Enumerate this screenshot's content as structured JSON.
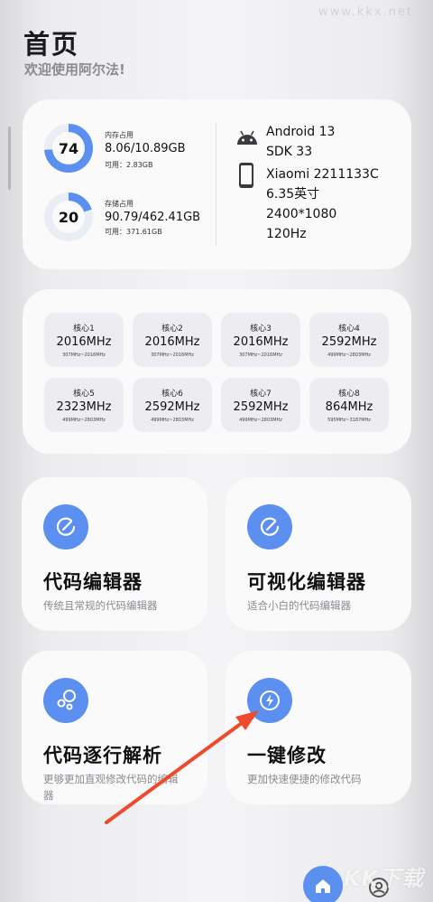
{
  "header": {
    "title": "首页",
    "subtitle": "欢迎使用阿尔法!"
  },
  "watermark": {
    "top": "www.kkx.net",
    "bottom": "KK下载"
  },
  "memory": {
    "percent": 74,
    "label": "内存占用",
    "value": "8.06/10.89GB",
    "available": "可用：2.83GB"
  },
  "storage": {
    "percent": 20,
    "label": "存储占用",
    "value": "90.79/462.41GB",
    "available": "可用：371.61GB"
  },
  "device": {
    "os_icon": "android-icon",
    "os_lines": [
      "Android 13",
      "SDK 33"
    ],
    "phone_icon": "smartphone-icon",
    "phone_lines": [
      "Xiaomi 2211133C",
      "6.35英寸",
      "2400*1080",
      "120Hz"
    ]
  },
  "cpu": {
    "cores": [
      {
        "name": "核心1",
        "freq": "2016MHz",
        "range": "307MHz~2016MHz"
      },
      {
        "name": "核心2",
        "freq": "2016MHz",
        "range": "307MHz~2016MHz"
      },
      {
        "name": "核心3",
        "freq": "2016MHz",
        "range": "307MHz~2016MHz"
      },
      {
        "name": "核心4",
        "freq": "2592MHz",
        "range": "499MHz~2803MHz"
      },
      {
        "name": "核心5",
        "freq": "2323MHz",
        "range": "499MHz~2803MHz"
      },
      {
        "name": "核心6",
        "freq": "2592MHz",
        "range": "499MHz~2803MHz"
      },
      {
        "name": "核心7",
        "freq": "2592MHz",
        "range": "499MHz~2803MHz"
      },
      {
        "name": "核心8",
        "freq": "864MHz",
        "range": "595MHz~3187MHz"
      }
    ]
  },
  "features": [
    {
      "icon": "edit-icon",
      "title": "代码编辑器",
      "desc": "传统且常规的代码编辑器"
    },
    {
      "icon": "edit-icon",
      "title": "可视化编辑器",
      "desc": "适合小白的代码编辑器"
    },
    {
      "icon": "bubbles-icon",
      "title": "代码逐行解析",
      "desc": "更够更加直观修改代码的编辑器"
    },
    {
      "icon": "lightning-icon",
      "title": "一键修改",
      "desc": "更加快速便捷的修改代码"
    }
  ],
  "colors": {
    "accent": "#5b8ff0",
    "annotation_arrow": "#ee4a2c"
  },
  "nav": {
    "home_icon": "home-icon",
    "profile_icon": "profile-icon"
  }
}
